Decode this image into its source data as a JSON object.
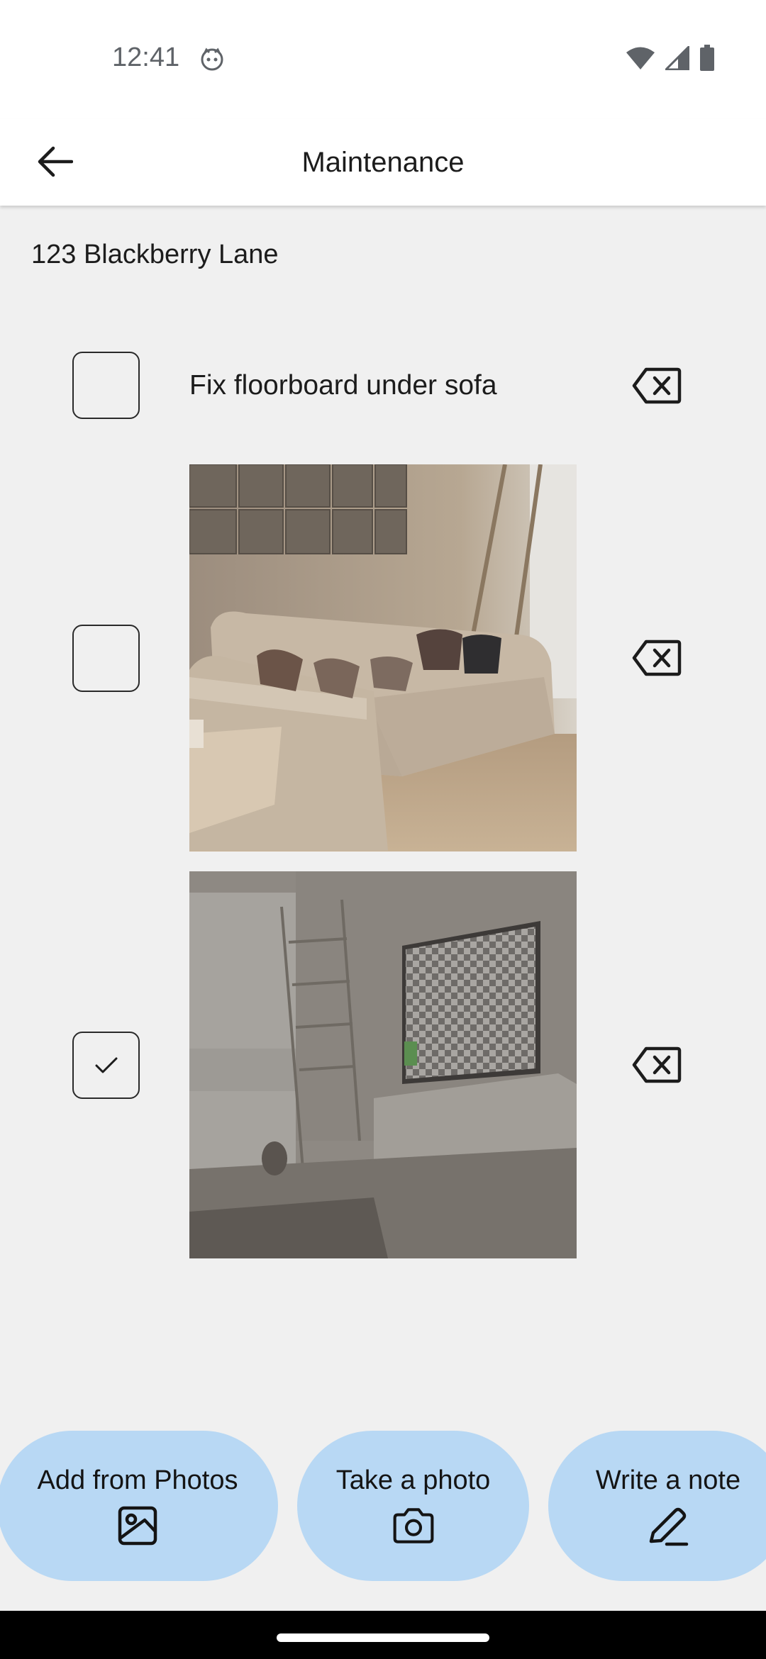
{
  "status_bar": {
    "time": "12:41",
    "icons": [
      "cat-face-icon",
      "wifi-icon",
      "cellular-signal-icon",
      "battery-icon"
    ]
  },
  "app_bar": {
    "title": "Maintenance",
    "back_icon": "arrow-left-icon"
  },
  "address": "123 Blackberry Lane",
  "items": [
    {
      "type": "note",
      "text": "Fix floorboard under sofa",
      "checked": false
    },
    {
      "type": "photo",
      "subject": "living-room sofa",
      "checked": false
    },
    {
      "type": "photo",
      "subject": "living-room TV stand",
      "checked": true
    }
  ],
  "actions": [
    {
      "label": "Add from Photos",
      "icon": "image-icon"
    },
    {
      "label": "Take a photo",
      "icon": "camera-icon"
    },
    {
      "label": "Write a note",
      "icon": "pencil-icon"
    }
  ],
  "colors": {
    "background": "#f0f0f0",
    "app_bar": "#ffffff",
    "action_pill": "#b8d8f4",
    "nav_bar": "#000000"
  }
}
